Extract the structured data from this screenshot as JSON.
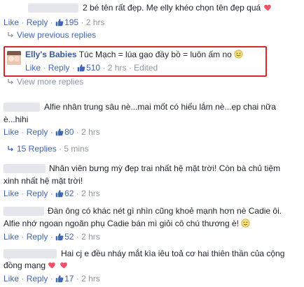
{
  "comments": [
    {
      "text": "2 bé tên rất đẹp. Mẹ elly khéo chọn tên đẹp quá",
      "like": "Like",
      "reply": "Reply",
      "likes": "195",
      "time": "2 hrs"
    },
    {
      "author": "Elly's Babies",
      "text": "Túc Mạch = lúa gạo đầy bồ = luôn ấm no",
      "like": "Like",
      "reply": "Reply",
      "likes": "510",
      "time": "2 hrs",
      "edited": "Edited"
    },
    {
      "text_line1": "Alfie nhân trung sâu nè...mai mốt có hiếu lắm nè...ẹp chai nữa",
      "text_line2": "è...hihi",
      "like": "Like",
      "reply": "Reply",
      "likes": "80",
      "time": "2 hrs"
    },
    {
      "text_line1": "Nhân viên bưng mỳ đẹp trai nhất hệ mặt trời! Còn bà chủ tiệm",
      "text_line2": "xinh nhất hệ mặt trời!",
      "like": "Like",
      "reply": "Reply",
      "likes": "62",
      "time": "2 hrs"
    },
    {
      "text_line1": "Đàn ông có khác nét gì nhìn cũng khoẻ mạnh hơn nè Cadie ôi.",
      "text_line2": "Alfie nhớ ngoan ngoãn phụ Cadie bán mì giỏi cô chú thương è!",
      "like": "Like",
      "reply": "Reply",
      "likes": "52",
      "time": "2 hrs"
    },
    {
      "text_line1": "Hai cj e đều nháy mắt kìa iêu toả cơ hai thiên thần của cộng",
      "text_line2": "đồng mạng",
      "like": "Like",
      "reply": "Reply",
      "likes": "17",
      "time": "2 hrs"
    }
  ],
  "view_previous_replies": "View previous replies",
  "view_more_replies": "View more replies",
  "replies_count": "15 Replies",
  "replies_time": "5 mins",
  "sep": "·",
  "colors": {
    "link": "#4267b2",
    "meta": "#90949c",
    "highlight": "#d9262d",
    "heart": "#f25268"
  },
  "icons": [
    "thumbs-up-icon",
    "heart-icon",
    "smile-icon",
    "reply-arrow-icon"
  ]
}
